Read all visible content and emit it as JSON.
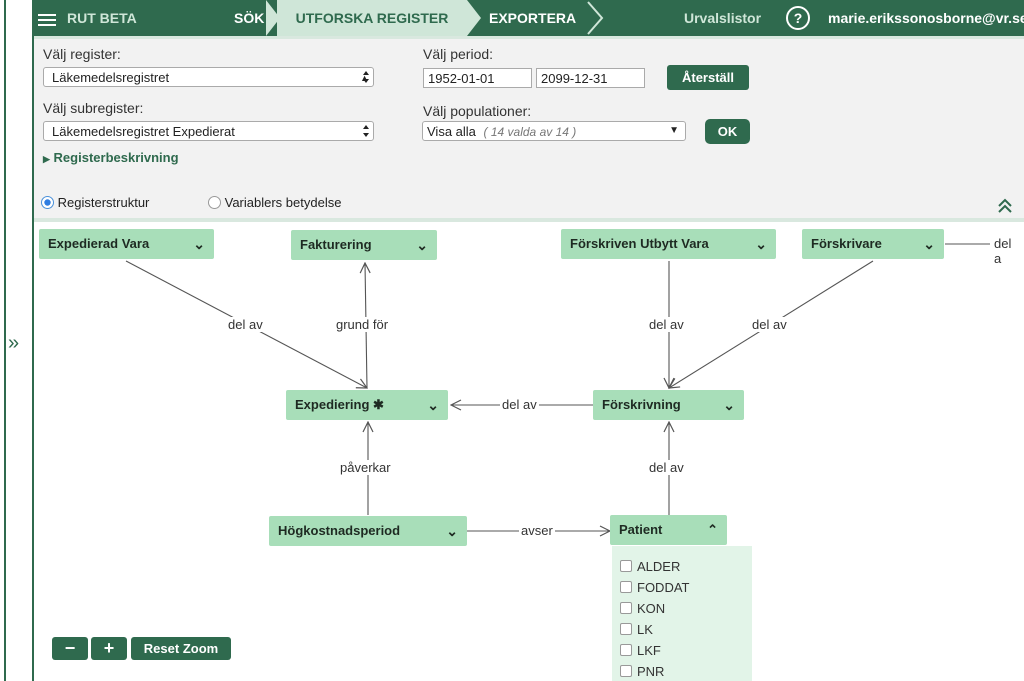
{
  "nav": {
    "brand": "RUT BETA",
    "sok": "SÖK",
    "utforska": "UTFORSKA REGISTER",
    "exportera": "EXPORTERA",
    "urvalslistor": "Urvalslistor",
    "help": "?",
    "user": "marie.erikssonosborne@vr.se ▾"
  },
  "form": {
    "register_label": "Välj register:",
    "register_value": "Läkemedelsregistret",
    "subregister_label": "Välj subregister:",
    "subregister_value": "Läkemedelsregistret Expedierat",
    "description_link": "Registerbeskrivning",
    "period_label": "Välj period:",
    "period_from": "1952-01-01",
    "period_to": "2099-12-31",
    "reset_button": "Återställ",
    "population_label": "Välj populationer:",
    "population_value": "Visa alla",
    "population_count": "( 14 valda av 14 )",
    "ok_button": "OK"
  },
  "view": {
    "radio_structure": "Registerstruktur",
    "radio_variables": "Variablers betydelse"
  },
  "graph": {
    "nodes": {
      "expedierad_vara": "Expedierad Vara",
      "fakturering": "Fakturering",
      "forskriven_utbytt_vara": "Förskriven Utbytt Vara",
      "forskrivare": "Förskrivare",
      "expediering": "Expediering ✱",
      "forskrivning": "Förskrivning",
      "hogkostnadsperiod": "Högkostnadsperiod",
      "patient": "Patient"
    },
    "edges": {
      "e1": "del av",
      "e2": "grund för",
      "e3": "del av",
      "e4": "del av",
      "e5": "del av",
      "e6": "påverkar",
      "e7": "del av",
      "e8": "avser",
      "e9": "del a"
    },
    "patient_vars": [
      "ALDER",
      "FODDAT",
      "KON",
      "LK",
      "LKF",
      "PNR"
    ]
  },
  "zoom": {
    "minus": "−",
    "plus": "+",
    "reset": "Reset Zoom"
  },
  "colors": {
    "primary": "#2f6a4e",
    "node": "#a8deb9",
    "panel": "#f2f2f2"
  }
}
